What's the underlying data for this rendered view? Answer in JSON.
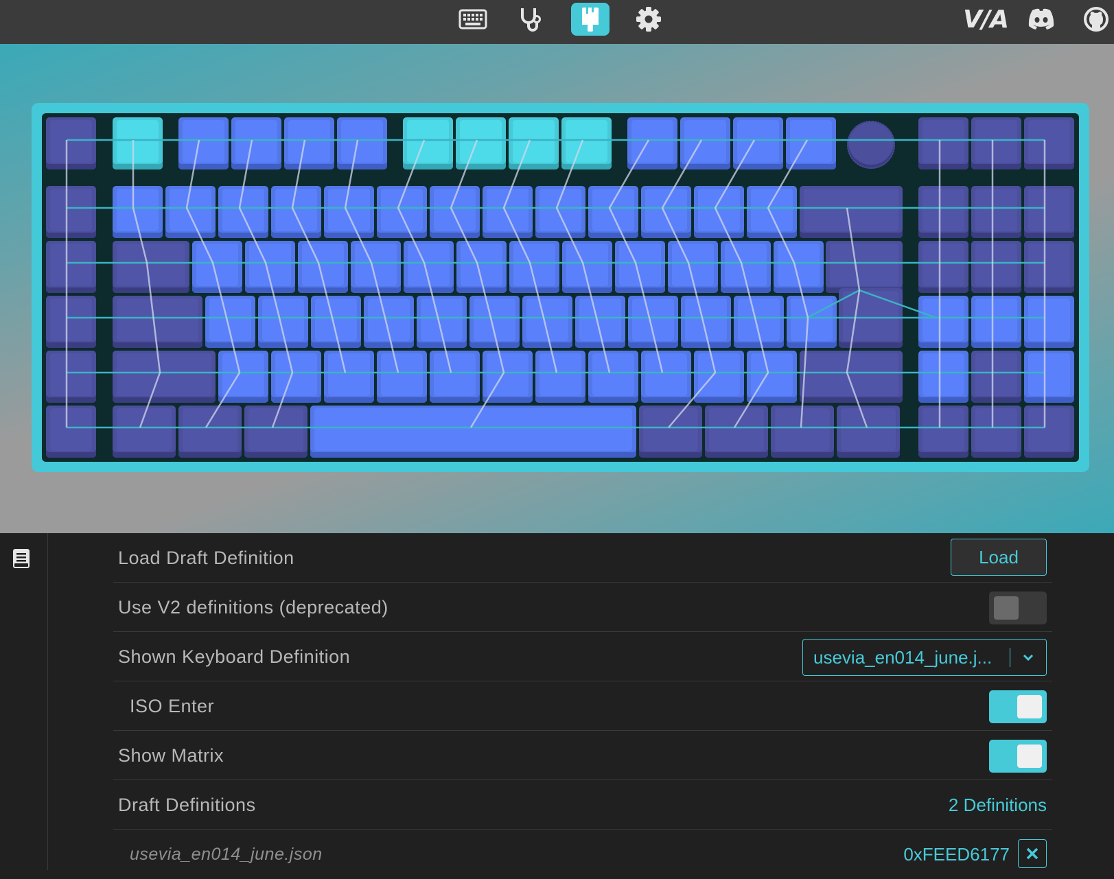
{
  "nav": {
    "items": [
      {
        "icon": "keyboard-icon",
        "active": false
      },
      {
        "icon": "stethoscope-icon",
        "active": false
      },
      {
        "icon": "paintbrush-icon",
        "active": true
      },
      {
        "icon": "gear-icon",
        "active": false
      }
    ],
    "brand_logo": "V/A",
    "links": [
      "discord-icon",
      "github-icon"
    ]
  },
  "colors": {
    "accent": "#47cad8",
    "key_blue": "#5377e8",
    "key_dark": "#4b4f9c",
    "frame": "#44c9d8",
    "panel_bg": "#202020",
    "topbar_bg": "#3b3b3b"
  },
  "settings": {
    "load_draft": {
      "label": "Load Draft Definition",
      "button": "Load"
    },
    "use_v2": {
      "label": "Use V2 definitions (deprecated)",
      "enabled": false
    },
    "shown_definition": {
      "label": "Shown Keyboard Definition",
      "value": "usevia_en014_june.j..."
    },
    "iso_enter": {
      "label": "ISO Enter",
      "enabled": true
    },
    "show_matrix": {
      "label": "Show Matrix",
      "enabled": true
    },
    "draft_definitions": {
      "label": "Draft Definitions",
      "count": "2 Definitions"
    },
    "definition_item": {
      "filename": "usevia_en014_june.json",
      "vendor_product_id": "0xFEED6177"
    }
  }
}
